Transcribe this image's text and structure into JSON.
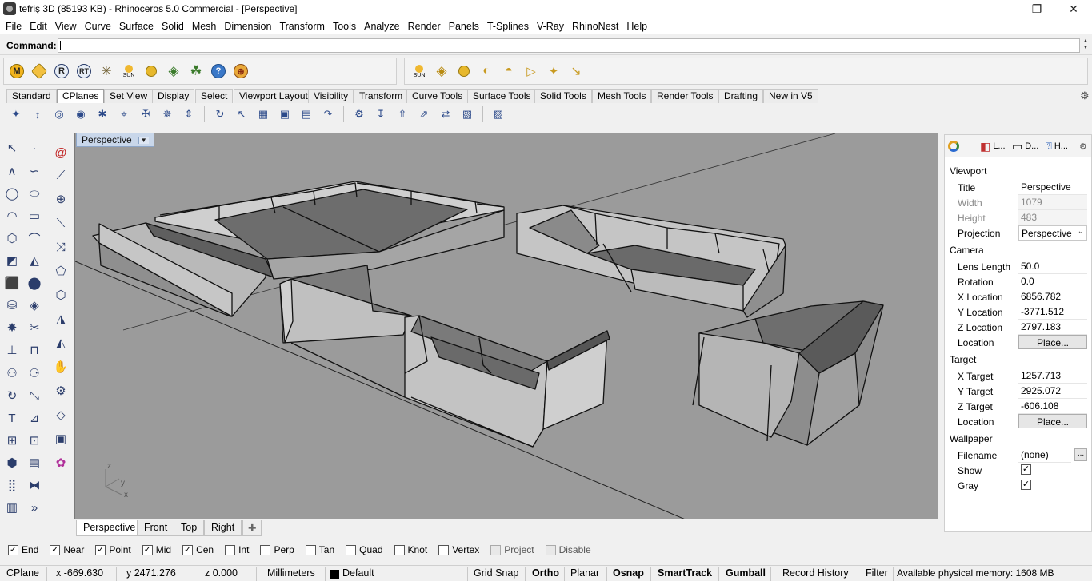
{
  "window": {
    "title": "tefriş 3D (85193 KB) - Rhinoceros 5.0 Commercial - [Perspective]",
    "minimize": "—",
    "maximize": "❐",
    "close": "✕"
  },
  "menu": [
    "File",
    "Edit",
    "View",
    "Curve",
    "Surface",
    "Solid",
    "Mesh",
    "Dimension",
    "Transform",
    "Tools",
    "Analyze",
    "Render",
    "Panels",
    "T-Splines",
    "V-Ray",
    "RhinoNest",
    "Help"
  ],
  "command": {
    "label": "Command:",
    "value": ""
  },
  "toolbar1": {
    "buttons": [
      {
        "glyph": "M",
        "name": "vray-material-editor-icon"
      },
      {
        "glyph": "◆",
        "name": "vray-options-icon"
      },
      {
        "glyph": "R",
        "name": "vray-render-icon"
      },
      {
        "glyph": "RT",
        "name": "vray-rt-icon"
      },
      {
        "glyph": "✳",
        "name": "vray-frame-buffer-icon"
      },
      {
        "glyph": "SUN",
        "name": "vray-sun-icon"
      },
      {
        "glyph": "●",
        "name": "vray-light-icon"
      },
      {
        "glyph": "◈",
        "name": "vray-dome-icon"
      },
      {
        "glyph": "☘",
        "name": "vray-fur-icon"
      },
      {
        "glyph": "?",
        "name": "vray-help-icon"
      },
      {
        "glyph": "⊕",
        "name": "vray-proxy-icon"
      }
    ]
  },
  "toolbar2": {
    "buttons": [
      {
        "glyph": "SUN",
        "name": "sun-light-icon"
      },
      {
        "glyph": "◈",
        "name": "ies-light-icon"
      },
      {
        "glyph": "●",
        "name": "sphere-light-icon"
      },
      {
        "glyph": "◐",
        "name": "spot-light-icon"
      },
      {
        "glyph": "◓",
        "name": "dome-light-icon"
      },
      {
        "glyph": "▷",
        "name": "rect-light-icon"
      },
      {
        "glyph": "✦",
        "name": "light-gen-icon"
      },
      {
        "glyph": "↘",
        "name": "directional-light-icon"
      }
    ]
  },
  "tabs": [
    "Standard",
    "CPlanes",
    "Set View",
    "Display",
    "Select",
    "Viewport Layout",
    "Visibility",
    "Transform",
    "Curve Tools",
    "Surface Tools",
    "Solid Tools",
    "Mesh Tools",
    "Render Tools",
    "Drafting",
    "New in V5"
  ],
  "active_tab": "CPlanes",
  "cplane_icons": [
    "✦",
    "↕",
    "◎",
    "◉",
    "✱",
    "⌖",
    "✠",
    "✵",
    "⇕",
    "↻",
    "↖",
    "▦",
    "▣",
    "▤",
    "↷",
    "⚙",
    "↧",
    "⇧",
    "⇗",
    "⇄",
    "▧",
    "▨"
  ],
  "viewport": {
    "label": "Perspective",
    "axes": {
      "x": "x",
      "y": "y",
      "z": "z"
    }
  },
  "view_tabs": [
    "Perspective",
    "Front",
    "Top",
    "Right",
    "✚"
  ],
  "right_tabs": [
    {
      "label": "",
      "icon": "properties-icon"
    },
    {
      "label": "L...",
      "icon": "layers-icon"
    },
    {
      "label": "D...",
      "icon": "display-icon"
    },
    {
      "label": "H...",
      "icon": "help-icon"
    }
  ],
  "properties": {
    "viewport_section": "Viewport",
    "title_label": "Title",
    "title_value": "Perspective",
    "width_label": "Width",
    "width_value": "1079",
    "height_label": "Height",
    "height_value": "483",
    "projection_label": "Projection",
    "projection_value": "Perspective",
    "camera_section": "Camera",
    "lens_label": "Lens Length",
    "lens_value": "50.0",
    "rotation_label": "Rotation",
    "rotation_value": "0.0",
    "xloc_label": "X Location",
    "xloc_value": "6856.782",
    "yloc_label": "Y Location",
    "yloc_value": "-3771.512",
    "zloc_label": "Z Location",
    "zloc_value": "2797.183",
    "location_label": "Location",
    "place_button": "Place...",
    "target_section": "Target",
    "xt_label": "X Target",
    "xt_value": "1257.713",
    "yt_label": "Y Target",
    "yt_value": "2925.072",
    "zt_label": "Z Target",
    "zt_value": "-606.108",
    "tlocation_label": "Location",
    "tplace_button": "Place...",
    "wallpaper_section": "Wallpaper",
    "filename_label": "Filename",
    "filename_value": "(none)",
    "browse_button": "...",
    "show_label": "Show",
    "gray_label": "Gray"
  },
  "osnaps": [
    {
      "label": "End",
      "checked": true,
      "enabled": true
    },
    {
      "label": "Near",
      "checked": true,
      "enabled": true
    },
    {
      "label": "Point",
      "checked": true,
      "enabled": true
    },
    {
      "label": "Mid",
      "checked": true,
      "enabled": true
    },
    {
      "label": "Cen",
      "checked": true,
      "enabled": true
    },
    {
      "label": "Int",
      "checked": false,
      "enabled": true
    },
    {
      "label": "Perp",
      "checked": false,
      "enabled": true
    },
    {
      "label": "Tan",
      "checked": false,
      "enabled": true
    },
    {
      "label": "Quad",
      "checked": false,
      "enabled": true
    },
    {
      "label": "Knot",
      "checked": false,
      "enabled": true
    },
    {
      "label": "Vertex",
      "checked": false,
      "enabled": true
    },
    {
      "label": "Project",
      "checked": false,
      "enabled": false
    },
    {
      "label": "Disable",
      "checked": false,
      "enabled": false
    }
  ],
  "status": {
    "cplane": "CPlane",
    "x": "x -669.630",
    "y": "y 2471.276",
    "z": "z 0.000",
    "units": "Millimeters",
    "layer": "Default",
    "grid_snap": "Grid Snap",
    "ortho": "Ortho",
    "planar": "Planar",
    "osnap": "Osnap",
    "smarttrack": "SmartTrack",
    "gumball": "Gumball",
    "record_history": "Record History",
    "filter": "Filter",
    "memory": "Available physical memory: 1608 MB"
  },
  "colors": {
    "viewport_bg": "#9b9b9b",
    "surface_light": "#c7c7c7",
    "surface_dark": "#6a6a6a",
    "edge": "#111111",
    "vptab": "#c9d7ea"
  }
}
